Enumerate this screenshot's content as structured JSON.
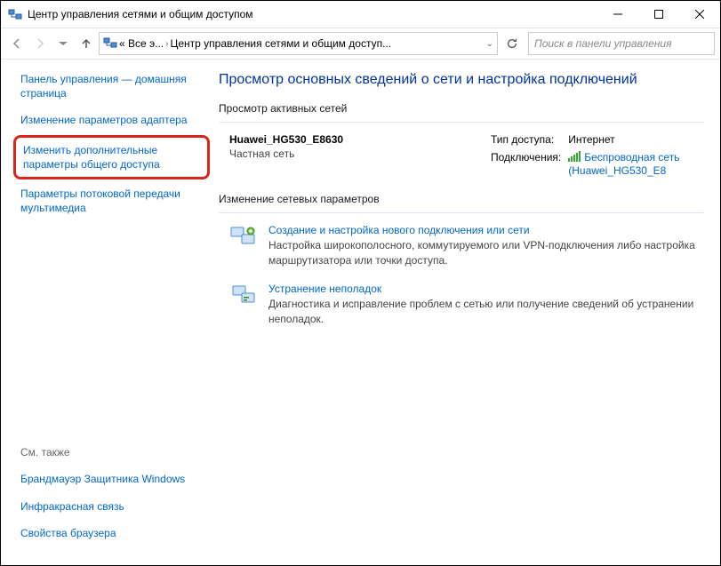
{
  "titlebar": {
    "text": "Центр управления сетями и общим доступом"
  },
  "address": {
    "seg1": "«  Все э...",
    "seg2": "Центр управления сетями и общим доступ..."
  },
  "search": {
    "placeholder": "Поиск в панели управления"
  },
  "sidebar": {
    "home": "Панель управления — домашняя страница",
    "adapter": "Изменение параметров адаптера",
    "sharing": "Изменить дополнительные параметры общего доступа",
    "media": "Параметры потоковой передачи мультимедиа",
    "seealso_hdr": "См. также",
    "firewall": "Брандмауэр Защитника Windows",
    "infra": "Инфракрасная связь",
    "browser": "Свойства браузера"
  },
  "main": {
    "heading": "Просмотр основных сведений о сети и настройка подключений",
    "active_hdr": "Просмотр активных сетей",
    "net_name": "Huawei_HG530_E8630",
    "net_type": "Частная сеть",
    "access_lbl": "Тип доступа:",
    "access_val": "Интернет",
    "conn_lbl": "Подключения:",
    "conn_val": "Беспроводная сеть (Huawei_HG530_E8",
    "change_hdr": "Изменение сетевых параметров",
    "setup_link": "Создание и настройка нового подключения или сети",
    "setup_desc": "Настройка широкополосного, коммутируемого или VPN-подключения либо настройка маршрутизатора или точки доступа.",
    "troub_link": "Устранение неполадок",
    "troub_desc": "Диагностика и исправление проблем с сетью или получение сведений об устранении неполадок."
  }
}
